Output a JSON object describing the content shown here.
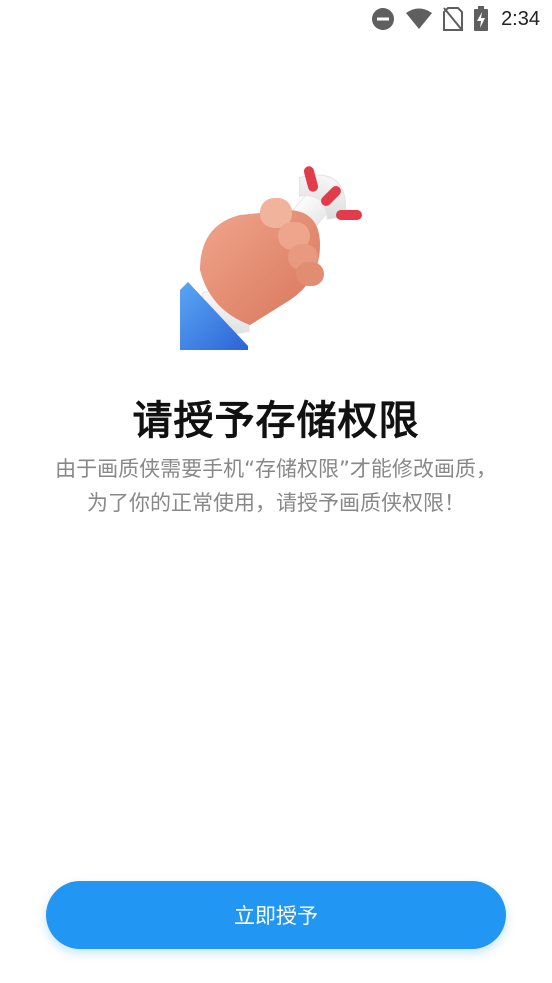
{
  "status_bar": {
    "time": "2:34",
    "icons": [
      "do-not-disturb-icon",
      "wifi-icon",
      "no-sim-icon",
      "battery-charging-icon"
    ]
  },
  "hero_icon": "wrench-in-hand-icon",
  "title": "请授予存储权限",
  "description": "由于画质侠需要手机“存储权限”才能修改画质，为了你的正常使用，请授予画质侠权限！",
  "button": {
    "label": "立即授予"
  },
  "colors": {
    "accent": "#2196F3",
    "title": "#111111",
    "description": "#888888"
  }
}
